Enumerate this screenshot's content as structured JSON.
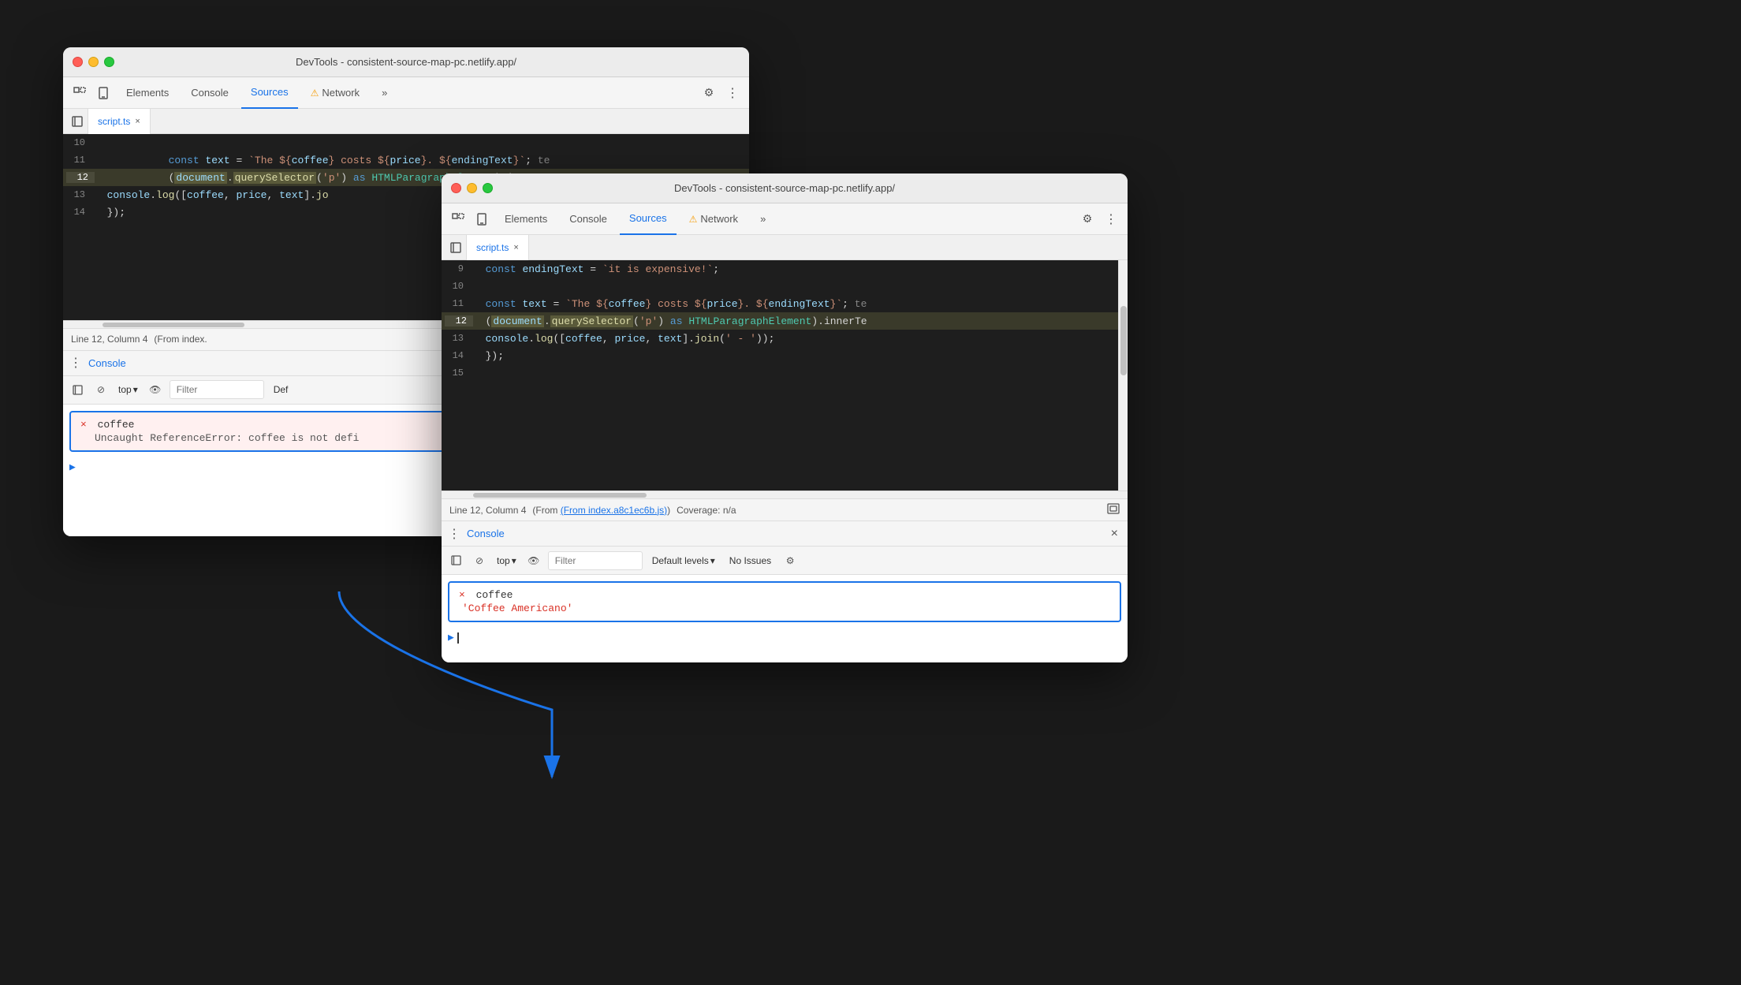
{
  "background_color": "#1a1a1a",
  "window_back": {
    "title": "DevTools - consistent-source-map-pc.netlify.app/",
    "tabs": [
      "Elements",
      "Console",
      "Sources",
      "Network"
    ],
    "active_tab": "Sources",
    "file_tab": "script.ts",
    "code_lines": [
      {
        "num": "10",
        "content": ""
      },
      {
        "num": "11",
        "content": "  const text = `The ${coffee} costs ${price}. ${endingText}`;"
      },
      {
        "num": "12",
        "content": "  (document.querySelector('p') as HTMLParagraphElement).innerT",
        "highlighted": true
      },
      {
        "num": "13",
        "content": "  console.log([coffee, price, text].jo"
      },
      {
        "num": "14",
        "content": "  });"
      }
    ],
    "status_bar": {
      "position": "Line 12, Column 4",
      "source": "(From index."
    },
    "console_label": "Console",
    "console_toolbar": {
      "top_label": "top",
      "filter_placeholder": "Filter",
      "default_levels": "Def"
    },
    "error": {
      "label": "coffee",
      "message": "Uncaught ReferenceError: coffee is not defi"
    }
  },
  "window_front": {
    "title": "DevTools - consistent-source-map-pc.netlify.app/",
    "tabs": [
      "Elements",
      "Console",
      "Sources",
      "Network"
    ],
    "active_tab": "Sources",
    "file_tab": "script.ts",
    "code_lines": [
      {
        "num": "9",
        "content": "  const endingText = `it is expensive!`;",
        "color": "#ce9178"
      },
      {
        "num": "10",
        "content": ""
      },
      {
        "num": "11",
        "content": "  const text = `The ${coffee} costs ${price}. ${endingText}`;"
      },
      {
        "num": "12",
        "content": "  (document.querySelector('p') as HTMLParagraphElement).innerTe",
        "highlighted": true
      },
      {
        "num": "13",
        "content": "  console.log([coffee, price, text].join(' - '));"
      },
      {
        "num": "14",
        "content": "  });"
      },
      {
        "num": "15",
        "content": ""
      }
    ],
    "status_bar": {
      "position": "Line 12, Column 4",
      "source": "(From index.a8c1ec6b.js)",
      "coverage": "Coverage: n/a"
    },
    "console_label": "Console",
    "console_toolbar": {
      "top_label": "top",
      "filter_placeholder": "Filter",
      "default_levels": "Default levels",
      "no_issues": "No Issues"
    },
    "success": {
      "label": "coffee",
      "value": "'Coffee Americano'"
    }
  },
  "icons": {
    "inspect": "⊡",
    "device": "⬜",
    "settings": "⚙",
    "more": "⋮",
    "sidebar": "▶",
    "clear": "⊘",
    "eye": "👁",
    "chevron_down": "▾",
    "close": "×",
    "prompt": ">",
    "dots": "⋮",
    "screenshot": "⬛"
  }
}
